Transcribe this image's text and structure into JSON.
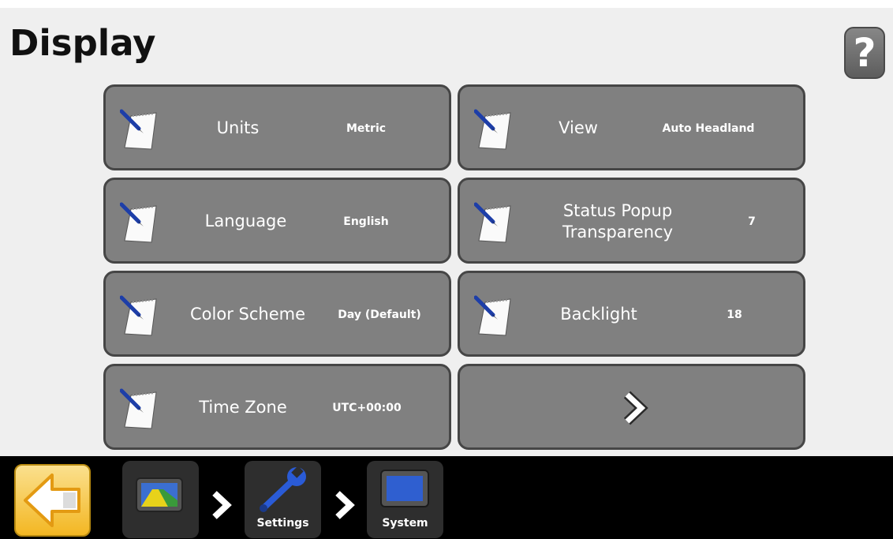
{
  "header": {
    "title": "Display",
    "help_label": "?"
  },
  "tiles": [
    {
      "label": "Units",
      "value": "Metric"
    },
    {
      "label": "View",
      "value": "Auto Headland"
    },
    {
      "label": "Language",
      "value": "English"
    },
    {
      "label": "Status Popup Transparency",
      "label_line1": "Status Popup",
      "label_line2": "Transparency",
      "value": "7"
    },
    {
      "label": "Color Scheme",
      "value": "Day (Default)"
    },
    {
      "label": "Backlight",
      "value": "18"
    },
    {
      "label": "Time Zone",
      "value": "UTC+00:00"
    }
  ],
  "next_page_icon": "chevron-right-icon",
  "breadcrumb": {
    "back_icon": "back-arrow-icon",
    "items": [
      {
        "icon": "guidance-display-icon",
        "label": ""
      },
      {
        "icon": "wrench-icon",
        "label": "Settings"
      },
      {
        "icon": "system-display-icon",
        "label": "System"
      }
    ]
  },
  "colors": {
    "tile_background": "#808080",
    "tile_border": "#464646",
    "page_background": "#efefef",
    "bottom_bar": "#000000",
    "back_button": "#f3b723"
  }
}
